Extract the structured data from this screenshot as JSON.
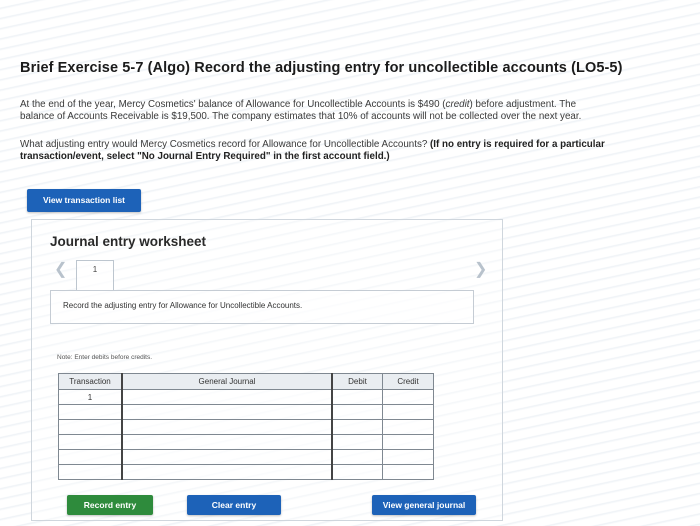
{
  "title": "Brief Exercise 5-7 (Algo) Record the adjusting entry for uncollectible accounts (LO5-5)",
  "paragraph1": {
    "line1_a": "At the end of the year, Mercy Cosmetics' balance of Allowance for Uncollectible Accounts is $490 (",
    "line1_credit": "credit",
    "line1_b": ") before adjustment. The",
    "line2": "balance of Accounts Receivable is $19,500. The company estimates that 10% of accounts will not be collected over the next year."
  },
  "paragraph2": {
    "question": "What adjusting entry would Mercy Cosmetics record for Allowance for Uncollectible Accounts?",
    "instruction_a": "(If no entry is required for a particular",
    "instruction_b": "transaction/event, select \"No Journal Entry Required\" in the first account field.)"
  },
  "buttons": {
    "view_transaction_list": "View transaction list",
    "record_entry": "Record entry",
    "clear_entry": "Clear entry",
    "view_general_journal": "View general journal"
  },
  "worksheet": {
    "title": "Journal entry worksheet",
    "prev_icon": "chevron-left-icon",
    "next_icon": "chevron-right-icon",
    "tab_number": "1",
    "instruction": "Record the adjusting entry for Allowance for Uncollectible Accounts.",
    "note": "Note: Enter debits before credits.",
    "table": {
      "headers": [
        "Transaction",
        "General Journal",
        "Debit",
        "Credit"
      ],
      "rows": [
        {
          "transaction": "1",
          "account": "",
          "debit": "",
          "credit": ""
        },
        {
          "transaction": "",
          "account": "",
          "debit": "",
          "credit": ""
        },
        {
          "transaction": "",
          "account": "",
          "debit": "",
          "credit": ""
        },
        {
          "transaction": "",
          "account": "",
          "debit": "",
          "credit": ""
        },
        {
          "transaction": "",
          "account": "",
          "debit": "",
          "credit": ""
        },
        {
          "transaction": "",
          "account": "",
          "debit": "",
          "credit": ""
        }
      ]
    }
  },
  "colors": {
    "primary_button": "#1d62b8",
    "record_button": "#2e8b3c"
  }
}
